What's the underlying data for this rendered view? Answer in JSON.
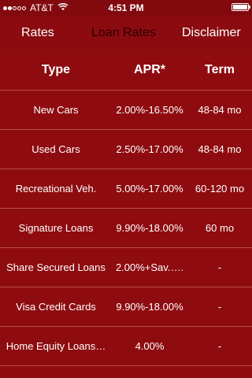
{
  "status_bar": {
    "carrier": "AT&T",
    "time": "4:51 PM"
  },
  "tabs": [
    {
      "label": "Rates"
    },
    {
      "label": "Loan Rates"
    },
    {
      "label": "Disclaimer"
    }
  ],
  "table": {
    "headers": [
      "Type",
      "APR*",
      "Term"
    ],
    "rows": [
      {
        "type": "New Cars",
        "apr": "2.00%-16.50%",
        "term": "48-84 mo"
      },
      {
        "type": "Used Cars",
        "apr": "2.50%-17.00%",
        "term": "48-84 mo"
      },
      {
        "type": "Recreational Veh.",
        "apr": "5.00%-17.00%",
        "term": "60-120 mo"
      },
      {
        "type": "Signature Loans",
        "apr": "9.90%-18.00%",
        "term": "60 mo"
      },
      {
        "type": "Share Secured Loans",
        "apr": "2.00%+Sav.….",
        "term": "-"
      },
      {
        "type": "Visa Credit Cards",
        "apr": "9.90%-18.00%",
        "term": "-"
      },
      {
        "type": "Home Equity Loans…",
        "apr": "4.00%",
        "term": "-"
      }
    ]
  }
}
